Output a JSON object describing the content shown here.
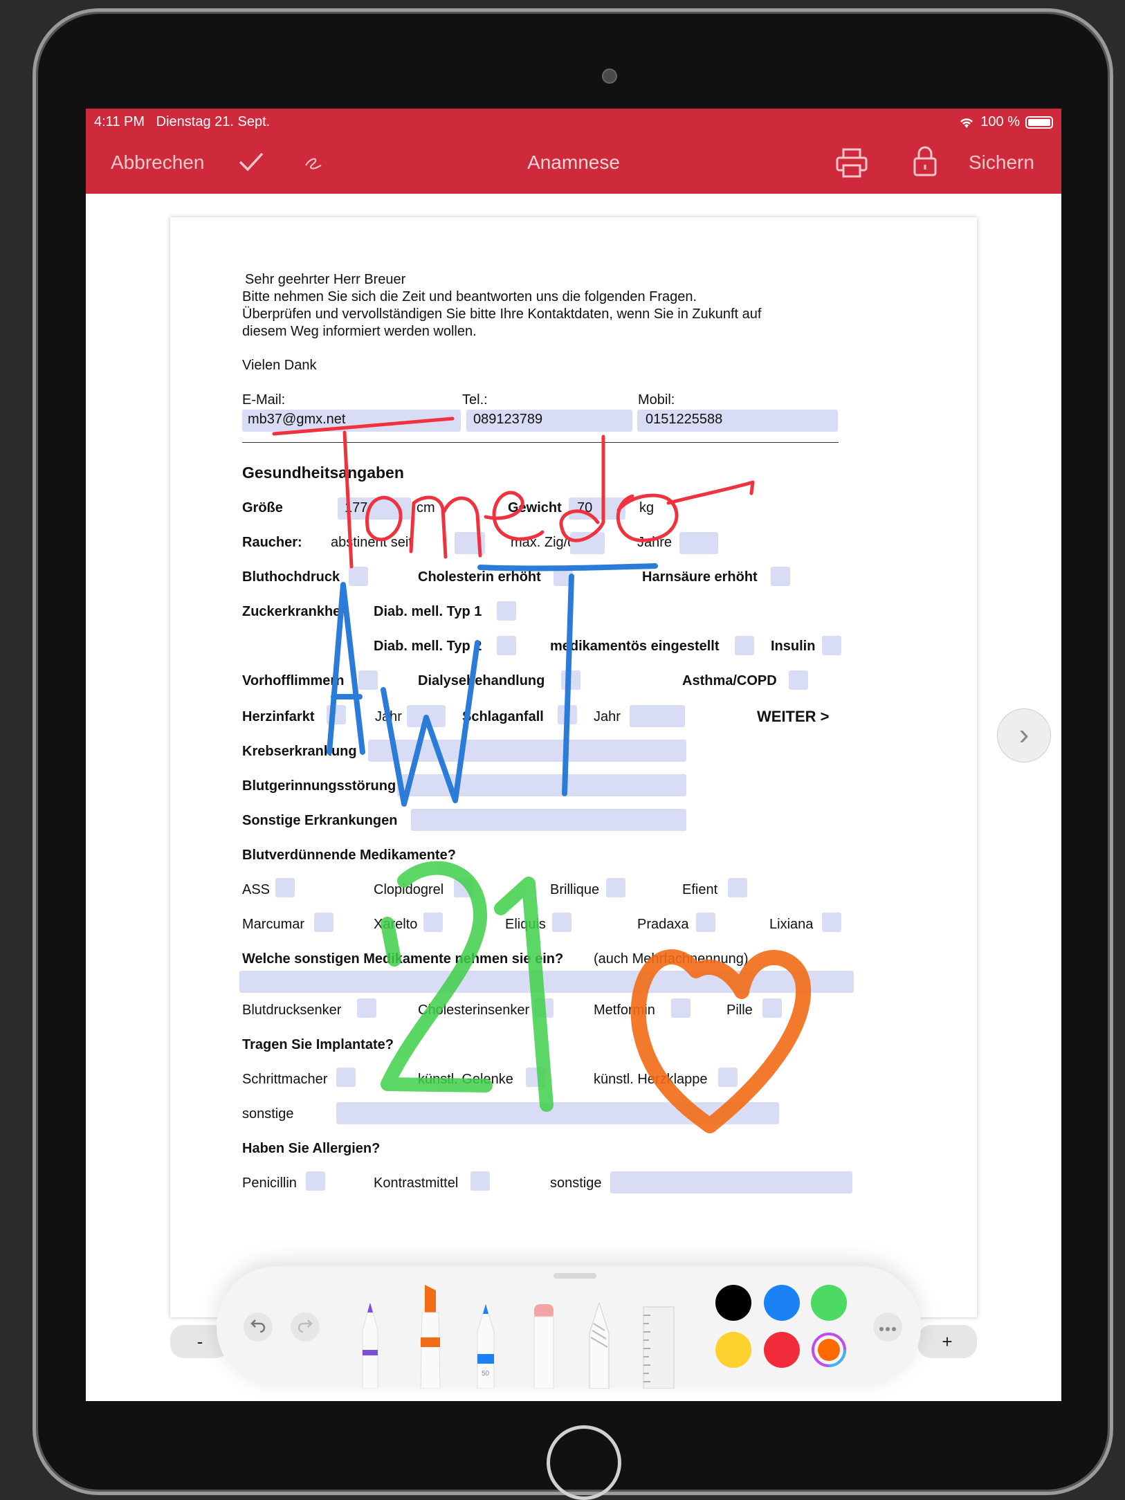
{
  "status_bar": {
    "time": "4:11 PM",
    "date": "Dienstag 21. Sept.",
    "battery": "100 %"
  },
  "nav": {
    "cancel": "Abbrechen",
    "title": "Anamnese",
    "save": "Sichern"
  },
  "form": {
    "intro1": "Sehr geehrter Herr Breuer",
    "intro2": "Bitte nehmen Sie sich die Zeit und beantworten uns die folgenden Fragen.",
    "intro3": "Überprüfen und vervollständigen Sie bitte Ihre Kontaktdaten, wenn  Sie in Zukunft auf",
    "intro4": "diesem Weg informiert werden wollen.",
    "thanks": "Vielen Dank",
    "email_label": "E-Mail:",
    "email_value": "mb37@gmx.net",
    "tel_label": "Tel.:",
    "tel_value": "089123789",
    "mobil_label": "Mobil:",
    "mobil_value": "0151225588",
    "section_health": "Gesundheitsangaben",
    "groesse": "Größe",
    "groesse_value": "177",
    "cm": "cm",
    "gewicht": "Gewicht",
    "gewicht_value": "70",
    "kg": "kg",
    "raucher": "Raucher:",
    "abstinent": "abstinent seit",
    "max": "max. Zig/d",
    "jahre": "Jahre",
    "bluthochdruck": "Bluthochdruck",
    "cholesterin": "Cholesterin erhöht",
    "harnsaeure": "Harnsäure erhöht",
    "zucker": "Zuckerkrankheit",
    "typ1": "Diab. mell. Typ 1",
    "typ2": "Diab. mell. Typ 2",
    "medikamentoes": "medikamentös eingestellt",
    "insulin": "Insulin",
    "vorhof": "Vorhofflimmern",
    "dialyse": "Dialysebehandlung",
    "asthma": "Asthma/COPD",
    "herzinfarkt": "Herzinfarkt",
    "jahr1": "Jahr",
    "schlaganfall": "Schlaganfall",
    "jahr2": "Jahr",
    "weiter": "WEITER >",
    "krebs": "Krebserkrankung",
    "blutgerinnung": "Blutgerinnungsstörung",
    "sonstige_erk": "Sonstige Erkrankungen",
    "blutverd": "Blutverdünnende Medikamente?",
    "ass": "ASS",
    "clopidogrel": "Clopidogrel",
    "brillique": "Brillique",
    "efient": "Efient",
    "marcumar": "Marcumar",
    "xarelto": "Xarelto",
    "eliquis": "Eliquis",
    "pradaxa": "Pradaxa",
    "lixiana": "Lixiana",
    "sonstige_med": "Welche sonstigen Medikamente nehmen sie ein?",
    "mehrfach": "(auch Mehrfachnennung)",
    "blutdruck": "Blutdrucksenker",
    "cholsenker": "Cholesterinsenker",
    "metformin": "Metformin",
    "pille": "Pille",
    "implantate": "Tragen Sie Implantate?",
    "schrittmacher": "Schrittmacher",
    "gelenke": "künstl. Gelenke",
    "herzklappe": "künstl. Herzklappe",
    "sonstige1": "sonstige",
    "allergien": "Haben Sie Allergien?",
    "penicillin": "Penicillin",
    "kontrast": "Kontrastmittel",
    "sonstige2": "sonstige"
  },
  "ink": {
    "red": "Tomedo",
    "blue": "AWT",
    "green": "21"
  },
  "zoom": {
    "minus": "-",
    "plus": "+"
  },
  "toolbar": {
    "marker_size": "50"
  },
  "colors": {
    "accent": "#cf2a3c",
    "field": "#d8dcf4",
    "ink_red": "#f0323f",
    "ink_blue": "#2b7bd9",
    "ink_green": "#3fcf4a",
    "ink_orange": "#f26b16",
    "swatches": [
      "#000000",
      "#1a82f5",
      "#4cd964",
      "#fed12e",
      "#f22b3a",
      "#ff6a00"
    ]
  }
}
